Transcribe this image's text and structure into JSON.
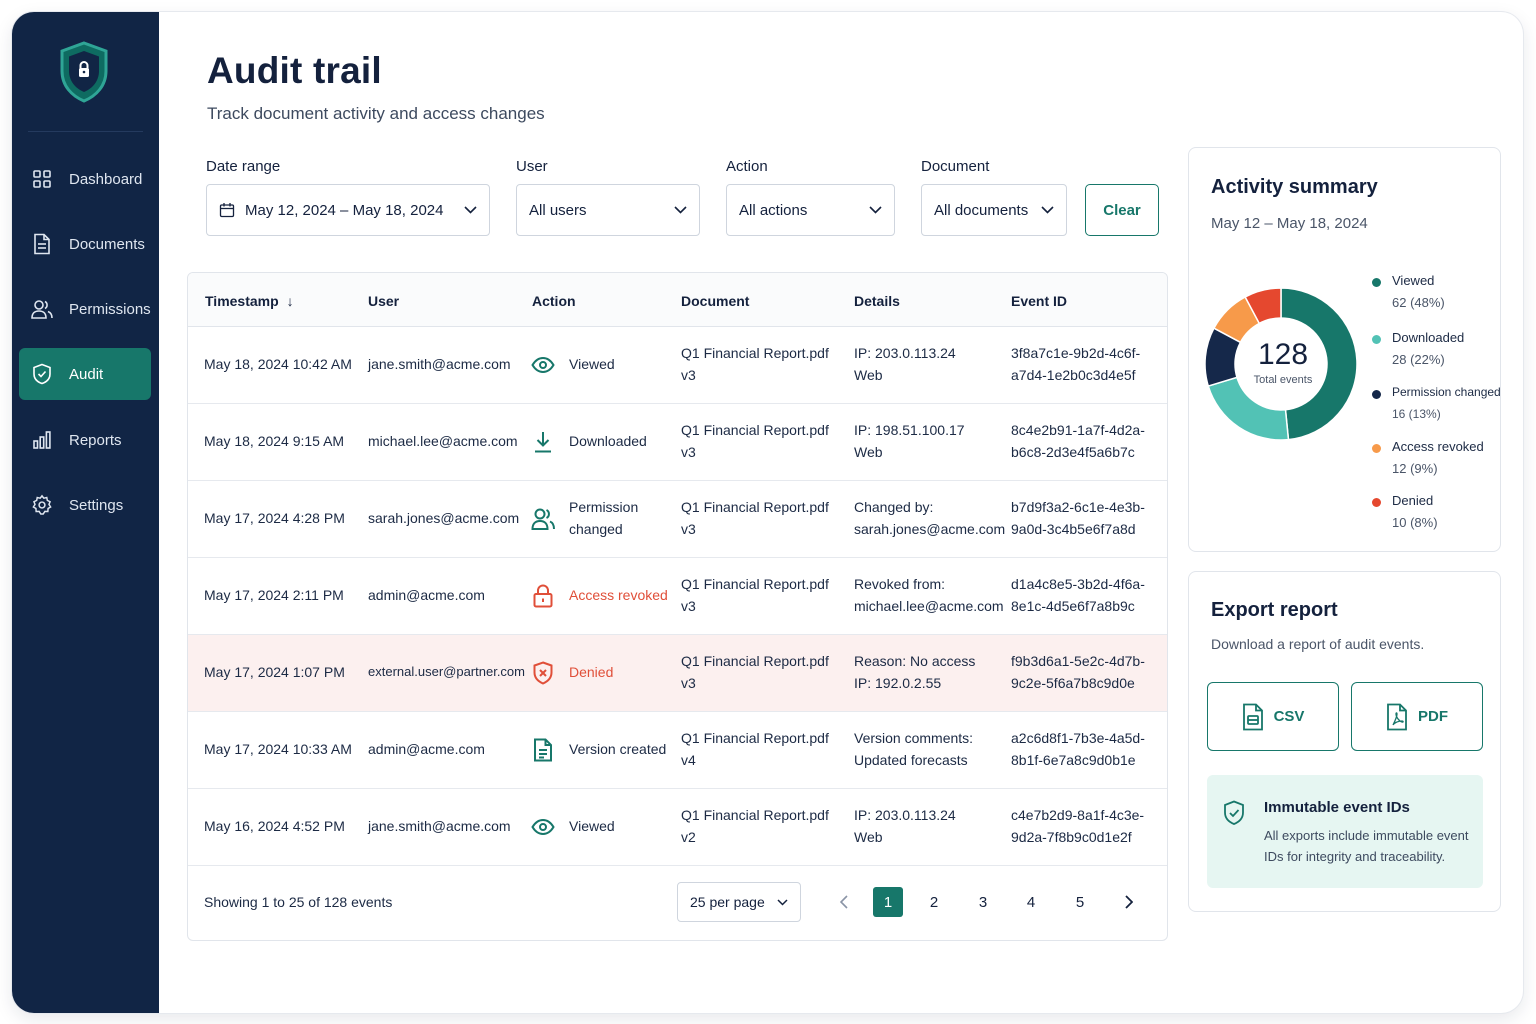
{
  "sidebar": {
    "items": [
      {
        "label": "Dashboard",
        "icon": "grid-icon"
      },
      {
        "label": "Documents",
        "icon": "document-icon"
      },
      {
        "label": "Permissions",
        "icon": "users-icon"
      },
      {
        "label": "Audit",
        "icon": "shield-check-icon",
        "active": true
      },
      {
        "label": "Reports",
        "icon": "bar-chart-icon"
      },
      {
        "label": "Settings",
        "icon": "gear-icon"
      }
    ]
  },
  "header": {
    "title": "Audit trail",
    "subtitle": "Track document activity and access changes"
  },
  "filters": {
    "date_range": {
      "label": "Date range",
      "value": "May 12, 2024 – May 18, 2024"
    },
    "user": {
      "label": "User",
      "value": "All users"
    },
    "action": {
      "label": "Action",
      "value": "All actions"
    },
    "document": {
      "label": "Document",
      "value": "All documents"
    },
    "clear_label": "Clear"
  },
  "table": {
    "columns": [
      "Timestamp",
      "User",
      "Action",
      "Document",
      "Details",
      "Event ID"
    ],
    "sort_indicator": "↓",
    "rows": [
      {
        "timestamp": "May 18, 2024 10:42 AM",
        "user": "jane.smith@acme.com",
        "action": [
          "Viewed"
        ],
        "action_icon": "eye-icon",
        "document": [
          "Q1 Financial Report.pdf",
          "v3"
        ],
        "details": [
          "IP: 203.0.113.24",
          "Web"
        ],
        "event_id": [
          "3f8a7c1e-9b2d-4c6f-",
          "a7d4-1e2b0c3d4e5f"
        ]
      },
      {
        "timestamp": "May 18, 2024 9:15 AM",
        "user": "michael.lee@acme.com",
        "action": [
          "Downloaded"
        ],
        "action_icon": "download-icon",
        "document": [
          "Q1 Financial Report.pdf",
          "v3"
        ],
        "details": [
          "IP: 198.51.100.17",
          "Web"
        ],
        "event_id": [
          "8c4e2b91-1a7f-4d2a-",
          "b6c8-2d3e4f5a6b7c"
        ]
      },
      {
        "timestamp": "May 17, 2024 4:28 PM",
        "user": "sarah.jones@acme.com",
        "action": [
          "Permission",
          "changed"
        ],
        "action_icon": "users-icon",
        "document": [
          "Q1 Financial Report.pdf",
          "v3"
        ],
        "details": [
          "Changed by:",
          "sarah.jones@acme.com"
        ],
        "event_id": [
          "b7d9f3a2-6c1e-4e3b-",
          "9a0d-3c4b5e6f7a8d"
        ]
      },
      {
        "timestamp": "May 17, 2024 2:11 PM",
        "user": "admin@acme.com",
        "action": [
          "Access revoked"
        ],
        "action_icon": "lock-icon",
        "alert": true,
        "document": [
          "Q1 Financial Report.pdf",
          "v3"
        ],
        "details": [
          "Revoked from:",
          "michael.lee@acme.com"
        ],
        "event_id": [
          "d1a4c8e5-3b2d-4f6a-",
          "8e1c-4d5e6f7a8b9c"
        ]
      },
      {
        "timestamp": "May 17, 2024 1:07 PM",
        "user": "external.user@partner.com",
        "action": [
          "Denied"
        ],
        "action_icon": "shield-x-icon",
        "alert": true,
        "highlight": true,
        "document": [
          "Q1 Financial Report.pdf",
          "v3"
        ],
        "details": [
          "Reason: No access",
          "IP: 192.0.2.55"
        ],
        "event_id": [
          "f9b3d6a1-5e2c-4d7b-",
          "9c2e-5f6a7b8c9d0e"
        ]
      },
      {
        "timestamp": "May 17, 2024 10:33 AM",
        "user": "admin@acme.com",
        "action": [
          "Version created"
        ],
        "action_icon": "file-text-icon",
        "document": [
          "Q1 Financial Report.pdf",
          "v4"
        ],
        "details": [
          "Version comments:",
          "Updated forecasts"
        ],
        "event_id": [
          "a2c6d8f1-7b3e-4a5d-",
          "8b1f-6e7a8c9d0b1e"
        ]
      },
      {
        "timestamp": "May 16, 2024 4:52 PM",
        "user": "jane.smith@acme.com",
        "action": [
          "Viewed"
        ],
        "action_icon": "eye-icon",
        "document": [
          "Q1 Financial Report.pdf",
          "v2"
        ],
        "details": [
          "IP: 203.0.113.24",
          "Web"
        ],
        "event_id": [
          "c4e7b2d9-8a1f-4c3e-",
          "9d2a-7f8b9c0d1e2f"
        ]
      }
    ],
    "footer": {
      "showing": "Showing 1  to 25 of 128 events",
      "per_page": "25 per page",
      "pages": [
        "1",
        "2",
        "3",
        "4",
        "5"
      ],
      "current_page": "1"
    }
  },
  "summary": {
    "title": "Activity summary",
    "date": "May 12 – May 18, 2024",
    "total": "128",
    "total_label": "Total events",
    "chart_data": {
      "type": "pie",
      "categories": [
        "Viewed",
        "Downloaded",
        "Permission changed",
        "Access revoked",
        "Denied"
      ],
      "values": [
        62,
        28,
        16,
        12,
        10
      ],
      "colors": [
        "#17776a",
        "#52c2b5",
        "#15284a",
        "#f79a4a",
        "#e5482f"
      ]
    },
    "legend": [
      {
        "name": "Viewed",
        "value": "62 (48%)"
      },
      {
        "name": "Downloaded",
        "value": "28 (22%)"
      },
      {
        "name": "Permission changed",
        "value": "16 (13%)"
      },
      {
        "name": "Access revoked",
        "value": "12 (9%)"
      },
      {
        "name": "Denied",
        "value": "10 (8%)"
      }
    ]
  },
  "export": {
    "title": "Export report",
    "subtitle": "Download a report of audit events.",
    "csv_label": "CSV",
    "pdf_label": "PDF",
    "info_title": "Immutable event IDs",
    "info_text": "All exports include immutable event IDs for integrity and traceability."
  },
  "colors": {
    "sidebar_bg": "#112545",
    "accent": "#17776a",
    "alert": "#e04f39",
    "denied_row_bg": "#fcf0ef"
  }
}
